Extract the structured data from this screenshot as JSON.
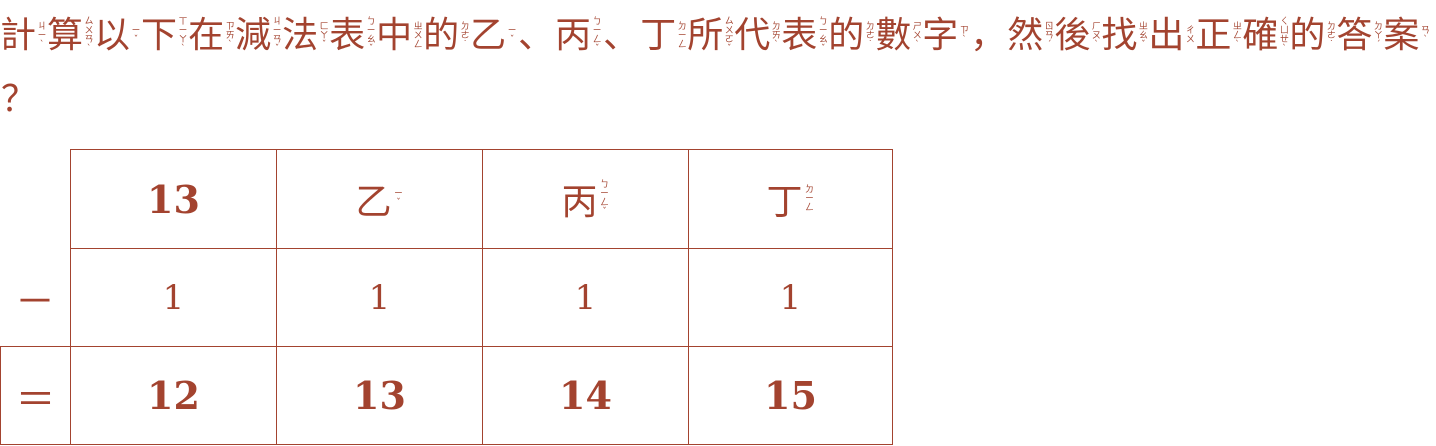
{
  "question": {
    "chars": [
      {
        "hz": "計",
        "zy": "ㄐㄧˋ"
      },
      {
        "hz": "算",
        "zy": "ㄙㄨㄢˋ"
      },
      {
        "hz": "以",
        "zy": "ㄧˇ"
      },
      {
        "hz": "下",
        "zy": "ㄒㄧㄚˋ"
      },
      {
        "hz": "在",
        "zy": "ㄗㄞˋ"
      },
      {
        "hz": "減",
        "zy": "ㄐㄧㄢˇ"
      },
      {
        "hz": "法",
        "zy": "ㄈㄚˇ"
      },
      {
        "hz": "表",
        "zy": "ㄅㄧㄠˇ"
      },
      {
        "hz": "中",
        "zy": "ㄓㄨㄥ"
      },
      {
        "hz": "的",
        "zy": "ㄉㄜ˙"
      },
      {
        "hz": "乙",
        "zy": "ㄧˇ"
      },
      {
        "hz": "、",
        "zy": ""
      },
      {
        "hz": "丙",
        "zy": "ㄅㄧㄥˇ"
      },
      {
        "hz": "、",
        "zy": ""
      },
      {
        "hz": "丁",
        "zy": "ㄉㄧㄥ"
      },
      {
        "hz": "所",
        "zy": "ㄙㄨㄛˇ"
      },
      {
        "hz": "代",
        "zy": "ㄉㄞˋ"
      },
      {
        "hz": "表",
        "zy": "ㄅㄧㄠˇ"
      },
      {
        "hz": "的",
        "zy": "ㄉㄜ˙"
      },
      {
        "hz": "數",
        "zy": "ㄕㄨˋ"
      },
      {
        "hz": "字",
        "zy": "ㄗˋ"
      },
      {
        "hz": "，",
        "zy": ""
      },
      {
        "hz": "然",
        "zy": "ㄖㄢˊ"
      },
      {
        "hz": "後",
        "zy": "ㄏㄡˋ"
      },
      {
        "hz": "找",
        "zy": "ㄓㄠˇ"
      },
      {
        "hz": "出",
        "zy": "ㄔㄨ"
      },
      {
        "hz": "正",
        "zy": "ㄓㄥˋ"
      },
      {
        "hz": "確",
        "zy": "ㄑㄩㄝˋ"
      },
      {
        "hz": "的",
        "zy": "ㄉㄜ˙"
      },
      {
        "hz": "答",
        "zy": "ㄉㄚˊ"
      },
      {
        "hz": "案",
        "zy": "ㄢˋ"
      },
      {
        "hz": "？",
        "zy": ""
      }
    ]
  },
  "table": {
    "operator_minus": "－",
    "operator_equals": "＝",
    "header": [
      {
        "text": "13",
        "zy": ""
      },
      {
        "text": "乙",
        "zy": "ㄧˇ"
      },
      {
        "text": "丙",
        "zy": "ㄅㄧㄥˇ"
      },
      {
        "text": "丁",
        "zy": "ㄉㄧㄥ"
      }
    ],
    "subtrahend": [
      "1",
      "1",
      "1",
      "1"
    ],
    "result": [
      "12",
      "13",
      "14",
      "15"
    ]
  },
  "colors": {
    "ink": "#a3432f",
    "background": "#ffffff"
  }
}
